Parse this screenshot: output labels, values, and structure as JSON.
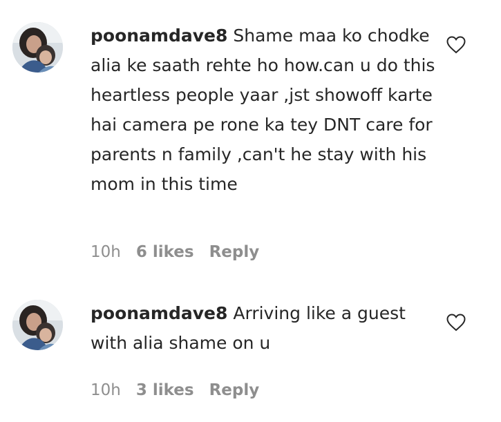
{
  "comments": [
    {
      "username": "poonamdave8",
      "text": "Shame maa ko chodke alia ke saath rehte ho how.can u do this heartless people yaar ,jst showoff karte hai camera pe rone ka tey DNT care for parents n family ,can't he stay with his mom in this time",
      "time": "10h",
      "likes": "6 likes",
      "reply": "Reply",
      "avatar_icon": "profile-avatar",
      "like_icon": "heart-icon"
    },
    {
      "username": "poonamdave8",
      "text": "Arriving like a guest with alia shame on u",
      "time": "10h",
      "likes": "3 likes",
      "reply": "Reply",
      "avatar_icon": "profile-avatar",
      "like_icon": "heart-icon"
    }
  ],
  "colors": {
    "text": "#262626",
    "meta": "#8e8e8e",
    "background": "#ffffff"
  }
}
